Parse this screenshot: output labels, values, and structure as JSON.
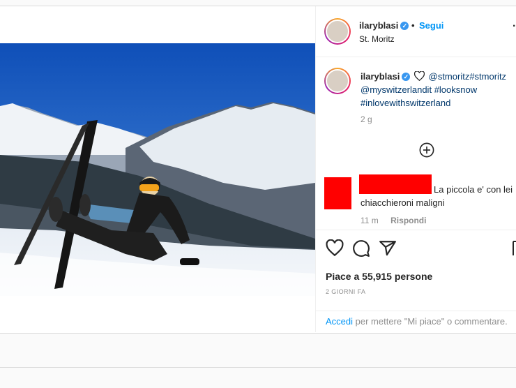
{
  "header": {
    "username": "ilaryblasi",
    "verified_icon": "verified-badge-icon",
    "separator": "•",
    "follow_label": "Segui",
    "location": "St. Moritz",
    "more_label": "..."
  },
  "caption": {
    "username": "ilaryblasi",
    "mention_1": "@stmoritz",
    "hashtag_1": "#stmoritz",
    "mention_2": "@myswitzerlandit",
    "hashtag_2": "#looksnow",
    "hashtag_3": "#inlovewithswitzerland",
    "time": "2 g"
  },
  "load_more_icon": "plus-circle-icon",
  "comment": {
    "text_line1": "La piccola e' con lei",
    "text_line2": "chiacchieroni maligni",
    "time": "11 m",
    "reply_label": "Rispondi",
    "redaction_color": "#ff0000"
  },
  "actions": {
    "icons": [
      "heart-icon",
      "comment-icon",
      "share-icon",
      "bookmark-icon"
    ],
    "likes_text": "Piace a 55,915 persone",
    "time_ago": "2 GIORNI FA"
  },
  "login_prompt": {
    "link": "Accedi",
    "text": " per mettere \"Mi piace\" o commentare."
  },
  "photo": {
    "alt": "ski-photo",
    "sky_color": "#1c5ec4"
  }
}
